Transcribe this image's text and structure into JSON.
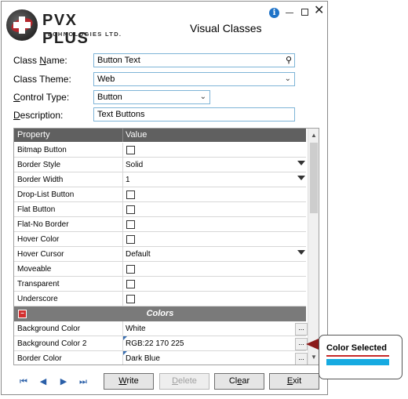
{
  "app": {
    "brand": "PVX PLUS",
    "brand_sub": "TECHNOLOGIES LTD.",
    "window_title": "Visual Classes"
  },
  "form": {
    "class_name": {
      "label_pre": "Class ",
      "label_key": "N",
      "label_post": "ame:",
      "value": "Button Text"
    },
    "class_theme": {
      "label": "Class Theme:",
      "value": "Web"
    },
    "control_type": {
      "label_key": "C",
      "label_post": "ontrol Type:",
      "value": "Button"
    },
    "description": {
      "label_key": "D",
      "label_post": "escription:",
      "value": "Text Buttons"
    }
  },
  "grid": {
    "headers": [
      "Property",
      "Value"
    ],
    "rows": [
      {
        "name": "Bitmap Button",
        "kind": "checkbox"
      },
      {
        "name": "Border Style",
        "kind": "dropdown",
        "value": "Solid"
      },
      {
        "name": "Border Width",
        "kind": "dropdown",
        "value": "1"
      },
      {
        "name": "Drop-List Button",
        "kind": "checkbox"
      },
      {
        "name": "Flat Button",
        "kind": "checkbox"
      },
      {
        "name": "Flat-No Border",
        "kind": "checkbox"
      },
      {
        "name": "Hover Color",
        "kind": "checkbox"
      },
      {
        "name": "Hover Cursor",
        "kind": "dropdown",
        "value": "Default"
      },
      {
        "name": "Moveable",
        "kind": "checkbox"
      },
      {
        "name": "Transparent",
        "kind": "checkbox"
      },
      {
        "name": "Underscore",
        "kind": "checkbox"
      }
    ],
    "section": {
      "title": "Colors"
    },
    "color_rows": [
      {
        "name": "Background Color",
        "value": "White"
      },
      {
        "name": "Background Color 2",
        "value": "RGB:22 170 225"
      },
      {
        "name": "Border Color",
        "value": "Dark Blue"
      }
    ]
  },
  "buttons": {
    "write_key": "W",
    "write_rest": "rite",
    "delete_key": "D",
    "delete_rest": "elete",
    "clear_pre": "Cl",
    "clear_key": "e",
    "clear_post": "ar",
    "exit_key": "E",
    "exit_rest": "xit"
  },
  "callout": {
    "text": "Color Selected",
    "swatch_color": "#16aae1"
  }
}
